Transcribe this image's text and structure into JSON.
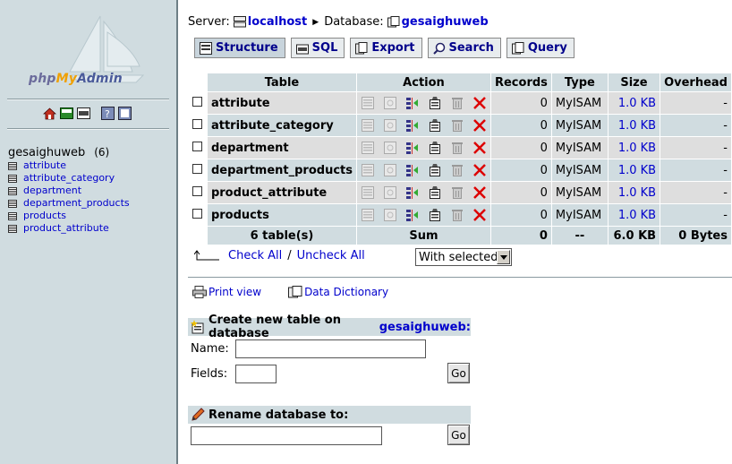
{
  "left": {
    "logo": {
      "php": "php",
      "my": "My",
      "admin": "Admin"
    },
    "db_name": "gesaighuweb",
    "db_count": "(6)",
    "tables": [
      "attribute",
      "attribute_category",
      "department",
      "department_products",
      "products",
      "product_attribute"
    ]
  },
  "breadcrumb": {
    "server_label": "Server:",
    "server": "localhost",
    "db_label": "Database:",
    "db": "gesaighuweb"
  },
  "tabs": [
    {
      "label": "Structure",
      "icon": "structure-icon",
      "active": true
    },
    {
      "label": "SQL",
      "icon": "sql-icon"
    },
    {
      "label": "Export",
      "icon": "export-icon"
    },
    {
      "label": "Search",
      "icon": "search-icon"
    },
    {
      "label": "Query",
      "icon": "query-icon"
    }
  ],
  "table": {
    "headers": {
      "table": "Table",
      "action": "Action",
      "records": "Records",
      "type": "Type",
      "size": "Size",
      "overhead": "Overhead"
    },
    "rows": [
      {
        "name": "attribute",
        "records": "0",
        "type": "MyISAM",
        "size": "1.0 KB",
        "overhead": "-"
      },
      {
        "name": "attribute_category",
        "records": "0",
        "type": "MyISAM",
        "size": "1.0 KB",
        "overhead": "-"
      },
      {
        "name": "department",
        "records": "0",
        "type": "MyISAM",
        "size": "1.0 KB",
        "overhead": "-"
      },
      {
        "name": "department_products",
        "records": "0",
        "type": "MyISAM",
        "size": "1.0 KB",
        "overhead": "-"
      },
      {
        "name": "product_attribute",
        "records": "0",
        "type": "MyISAM",
        "size": "1.0 KB",
        "overhead": "-"
      },
      {
        "name": "products",
        "records": "0",
        "type": "MyISAM",
        "size": "1.0 KB",
        "overhead": "-"
      }
    ],
    "footer": {
      "tables": "6 table(s)",
      "sum": "Sum",
      "records": "0",
      "type": "--",
      "size": "6.0 KB",
      "overhead": "0 Bytes"
    }
  },
  "check": {
    "check_all": "Check All",
    "sep": "/",
    "uncheck_all": "Uncheck All",
    "with_selected": "With selected:"
  },
  "links": {
    "print": "Print view",
    "dict": "Data Dictionary"
  },
  "create": {
    "title": "Create new table on database",
    "db": "gesaighuweb:",
    "name_label": "Name:",
    "fields_label": "Fields:",
    "go": "Go",
    "name_value": "",
    "fields_value": ""
  },
  "rename": {
    "title": "Rename database to:",
    "go": "Go",
    "value": ""
  }
}
